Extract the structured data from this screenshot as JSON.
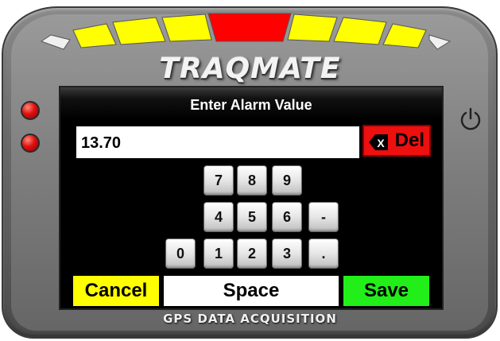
{
  "device": {
    "brand": "TRAQMATE",
    "tagline": "GPS DATA ACQUISITION"
  },
  "shift_lights": {
    "colors": [
      "#f0f0f0",
      "#ffff00",
      "#ffff00",
      "#ffff00",
      "#ff0000",
      "#ffff00",
      "#ffff00",
      "#ffff00",
      "#f0f0f0"
    ]
  },
  "icons": {
    "led": "red-led-icon",
    "power": "power-icon",
    "delete": "backspace-x-icon"
  },
  "screen": {
    "title": "Enter Alarm Value",
    "value": "13.70",
    "del_icon_label": "X",
    "del_label": "Del",
    "keypad": {
      "row1": [
        "7",
        "8",
        "9"
      ],
      "row2": [
        "4",
        "5",
        "6",
        "-"
      ],
      "row3": [
        "0",
        "1",
        "2",
        "3",
        "."
      ]
    },
    "cancel_label": "Cancel",
    "space_label": "Space",
    "save_label": "Save"
  },
  "colors": {
    "cancel": "#ffff00",
    "save": "#22ee1a",
    "delete": "#ee0f0f"
  }
}
